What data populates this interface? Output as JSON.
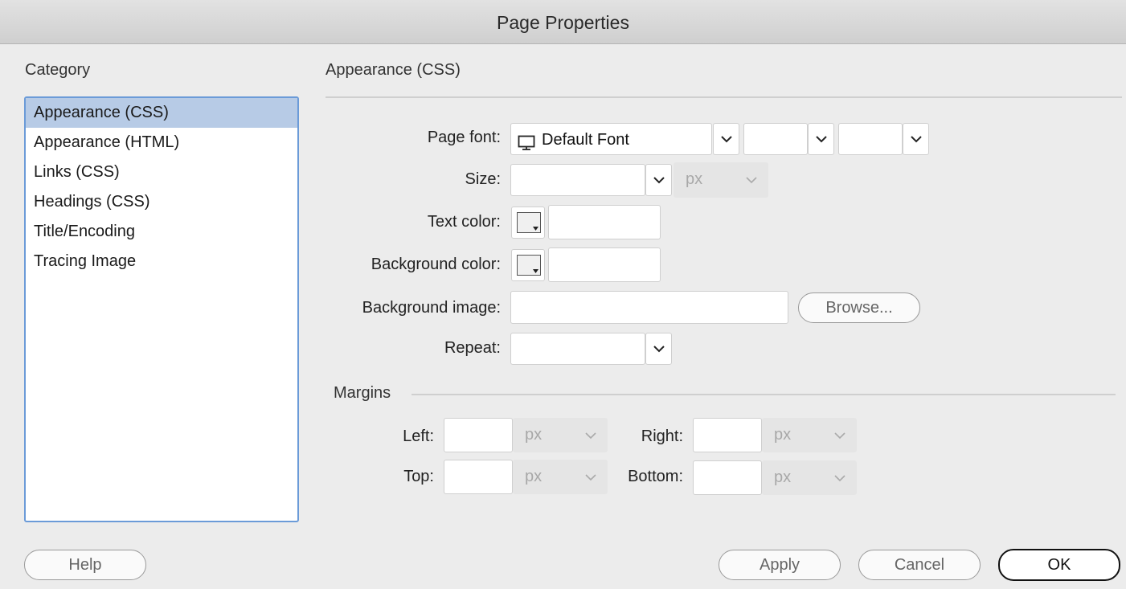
{
  "window": {
    "title": "Page Properties"
  },
  "category": {
    "heading": "Category",
    "items": [
      "Appearance (CSS)",
      "Appearance (HTML)",
      "Links (CSS)",
      "Headings (CSS)",
      "Title/Encoding",
      "Tracing Image"
    ],
    "selected_index": 0
  },
  "panel": {
    "title": "Appearance (CSS)",
    "page_font": {
      "label": "Page font:",
      "value": "Default Font",
      "style_value": "",
      "weight_value": "",
      "icon": "monitor-icon"
    },
    "size": {
      "label": "Size:",
      "value": "",
      "unit": "px"
    },
    "text_color": {
      "label": "Text color:",
      "value": ""
    },
    "background_color": {
      "label": "Background color:",
      "value": ""
    },
    "background_image": {
      "label": "Background image:",
      "value": "",
      "browse_label": "Browse..."
    },
    "repeat": {
      "label": "Repeat:",
      "value": ""
    }
  },
  "margins": {
    "heading": "Margins",
    "left": {
      "label": "Left:",
      "value": "",
      "unit": "px"
    },
    "right": {
      "label": "Right:",
      "value": "",
      "unit": "px"
    },
    "top": {
      "label": "Top:",
      "value": "",
      "unit": "px"
    },
    "bottom": {
      "label": "Bottom:",
      "value": "",
      "unit": "px"
    }
  },
  "buttons": {
    "help": "Help",
    "apply": "Apply",
    "cancel": "Cancel",
    "ok": "OK"
  }
}
